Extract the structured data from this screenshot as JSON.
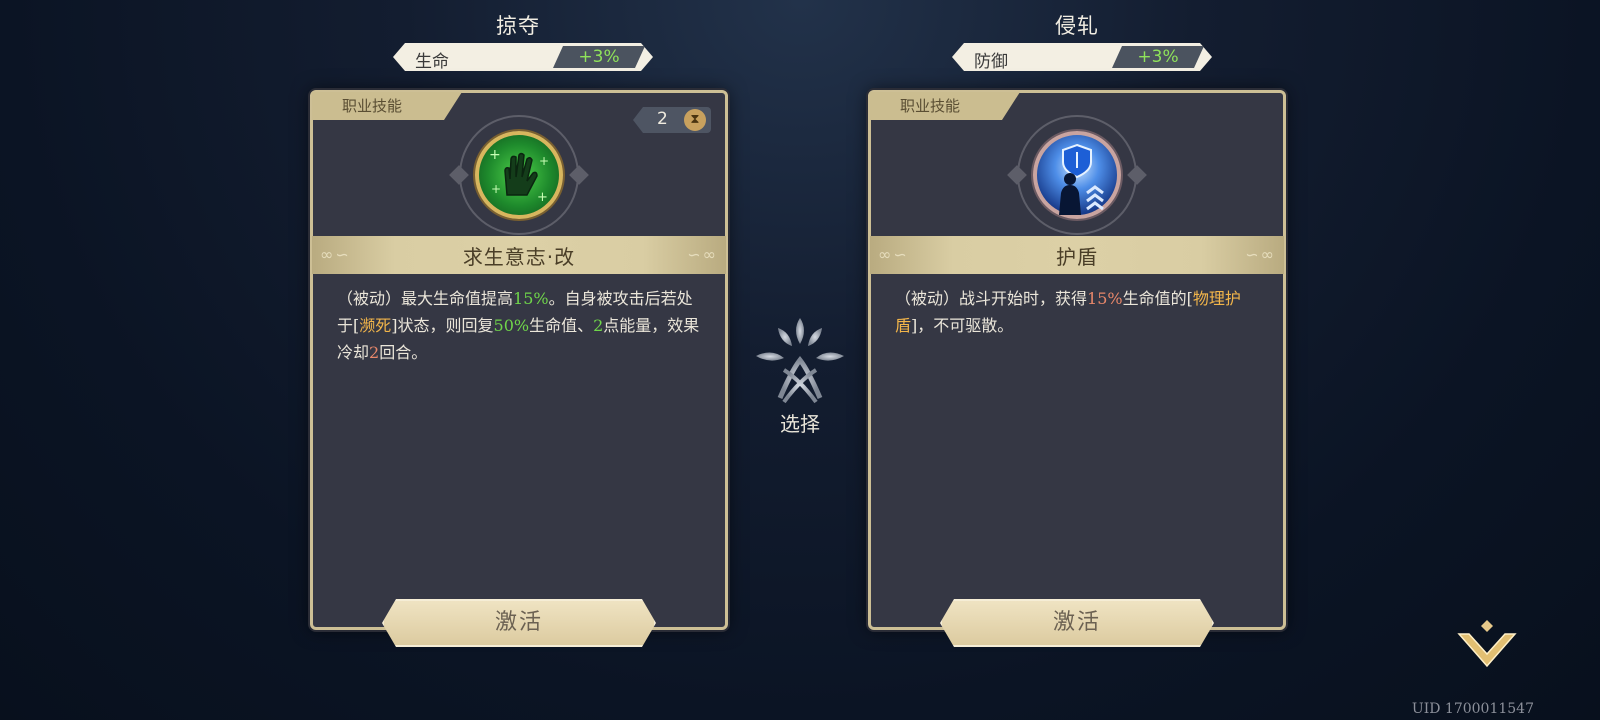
{
  "left_path": {
    "title": "掠夺",
    "stat_label": "生命",
    "stat_value": "+3%",
    "card_tag": "职业技能",
    "cooldown": "2",
    "skill_name": "求生意志·改",
    "desc": {
      "p1": "（被动）最大生命值提高",
      "v1": "15%",
      "p2": "。自身被攻击后若处于[",
      "v2": "濒死",
      "p3": "]状态，则回复",
      "v3": "50%",
      "p4": "生命值、",
      "v4": "2",
      "p5": "点能量，效果冷却",
      "v5": "2",
      "p6": "回合。"
    },
    "activate_label": "激活"
  },
  "right_path": {
    "title": "侵轧",
    "stat_label": "防御",
    "stat_value": "+3%",
    "card_tag": "职业技能",
    "skill_name": "护盾",
    "desc": {
      "p1": "（被动）战斗开始时，获得",
      "v1": "15%",
      "p2": "生命值的[",
      "v2": "物理护盾",
      "p3": "]，不可驱散。"
    },
    "activate_label": "激活"
  },
  "center": {
    "choose_label": "选择"
  },
  "footer": {
    "uid": "UID 1700011547"
  },
  "icons": {
    "left_skill": "green-hand-regeneration-icon",
    "right_skill": "blue-shield-figure-icon",
    "choose": "tree-leaves-emblem-icon",
    "cooldown": "hourglass-icon",
    "collapse": "chevron-down-icon"
  },
  "colors": {
    "stat_green": "#8fe25a",
    "value_green": "#6fd54a",
    "keyword_orange": "#f2b54a",
    "value_red": "#e8876a",
    "card_gold": "#cdbf95"
  }
}
